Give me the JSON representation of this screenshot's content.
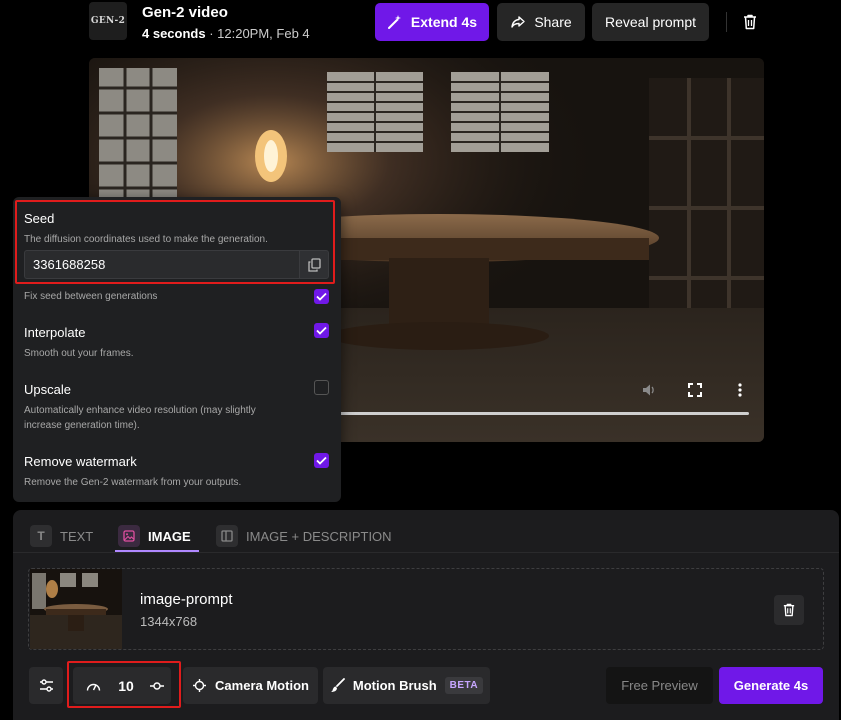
{
  "header": {
    "logo_text": "GEN-2",
    "title": "Gen-2 video",
    "duration": "4 seconds",
    "meta": " · 12:20PM, Feb 4",
    "extend_label": "Extend 4s",
    "share_label": "Share",
    "reveal_label": "Reveal prompt"
  },
  "settings": {
    "seed_label": "Seed",
    "seed_desc": "The diffusion coordinates used to make the generation.",
    "seed_value": "3361688258",
    "fix_seed_desc": "Fix seed between generations",
    "fix_seed_checked": true,
    "interpolate_label": "Interpolate",
    "interpolate_desc": "Smooth out your frames.",
    "interpolate_checked": true,
    "upscale_label": "Upscale",
    "upscale_desc_1": "Automatically enhance video resolution (may slightly",
    "upscale_desc_2": "increase generation time).",
    "upscale_checked": false,
    "watermark_label": "Remove watermark",
    "watermark_desc": "Remove the Gen-2 watermark from your outputs.",
    "watermark_checked": true
  },
  "tabs": [
    {
      "label": "TEXT",
      "icon": "text-icon",
      "active": false
    },
    {
      "label": "IMAGE",
      "icon": "image-icon",
      "active": true
    },
    {
      "label": "IMAGE + DESCRIPTION",
      "icon": "image-description-icon",
      "active": false
    }
  ],
  "image_prompt": {
    "name": "image-prompt",
    "size": "1344x768"
  },
  "toolbar": {
    "speed_value": "10",
    "camera_motion_label": "Camera Motion",
    "motion_brush_label": "Motion Brush",
    "beta_label": "BETA",
    "free_preview_label": "Free Preview",
    "generate_label": "Generate 4s"
  },
  "colors": {
    "accent": "#7018e8",
    "highlight": "#e01c1c"
  }
}
